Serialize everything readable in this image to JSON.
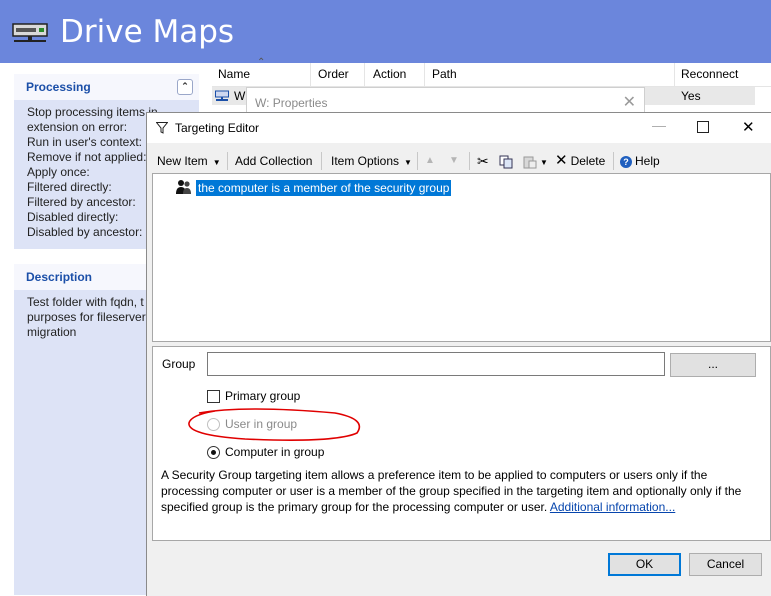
{
  "banner": {
    "title": "Drive Maps"
  },
  "processing_panel": {
    "title": "Processing",
    "lines": [
      "Stop processing items in",
      "extension on error:",
      "Run in user's context:",
      "Remove if not applied:",
      "Apply once:",
      "Filtered directly:",
      "Filtered by ancestor:",
      "Disabled directly:",
      "Disabled by ancestor:"
    ]
  },
  "description_panel": {
    "title": "Description",
    "lines": [
      "Test folder with fqdn, t",
      "purposes for fileserver",
      "migration"
    ]
  },
  "list": {
    "columns": [
      "Name",
      "Order",
      "Action",
      "Path",
      "Reconnect"
    ],
    "row": {
      "name": "W",
      "reconnect": "Yes"
    }
  },
  "properties_window": {
    "title": "W: Properties"
  },
  "targeting_editor": {
    "title": "Targeting Editor",
    "toolbar": {
      "new_item": "New Item",
      "add_collection": "Add Collection",
      "item_options": "Item Options",
      "delete": "Delete",
      "help": "Help"
    },
    "tree_item": "the computer is a member of the security group",
    "group_label": "Group",
    "group_value": "",
    "browse_label": "...",
    "primary_group_label": "Primary group",
    "user_in_group_label": "User in group",
    "computer_in_group_label": "Computer in group",
    "description": "A Security Group targeting item allows a preference item to be applied to computers or users only if the processing computer or user is a member of the group specified in the targeting item and optionally only if the specified group is the primary group for the processing computer or user.",
    "link_text": "Additional information...",
    "ok_label": "OK",
    "cancel_label": "Cancel"
  },
  "colors": {
    "banner": "#6b86dc",
    "panel": "#dde3f6",
    "selection": "#0078d7",
    "annotation": "#e00000"
  }
}
